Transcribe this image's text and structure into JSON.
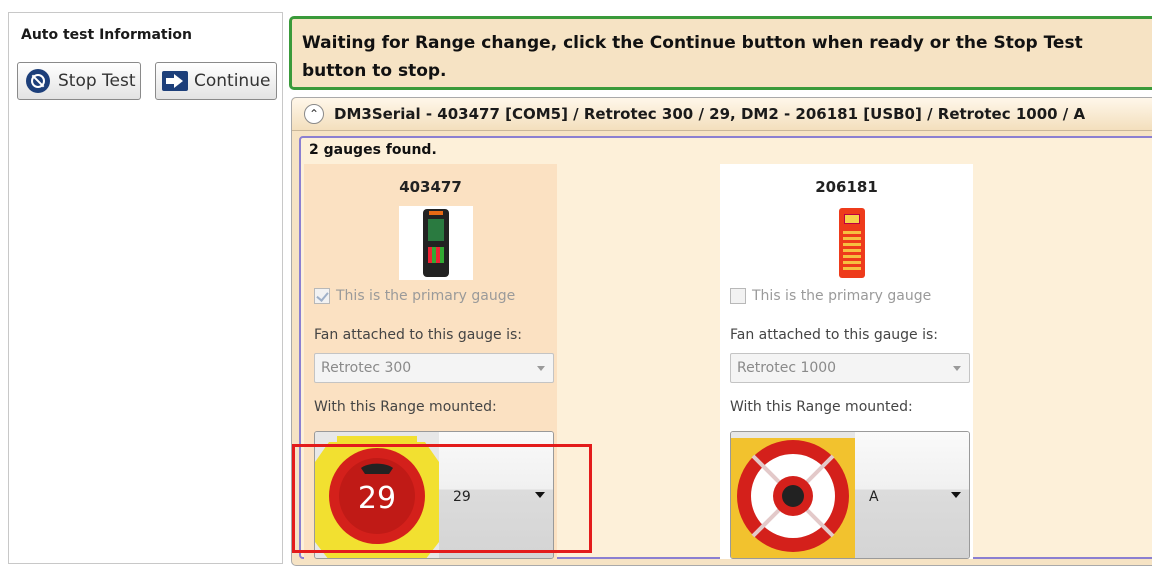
{
  "left_panel": {
    "title": "Auto test Information",
    "stop_label": "Stop Test",
    "continue_label": "Continue"
  },
  "banner": {
    "message": "Waiting for Range change, click the Continue button when ready or the Stop Test button to stop."
  },
  "device_panel": {
    "title": "DM3Serial - 403477 [COM5] / Retrotec 300 / 29, DM2 - 206181 [USB0] / Retrotec 1000 / A",
    "found_text": "2 gauges found.",
    "gauges": [
      {
        "id": "403477",
        "primary_label": "This is the primary gauge",
        "primary_checked": true,
        "fan_label": "Fan attached to this gauge is:",
        "fan_value": "Retrotec 300",
        "range_label": "With this Range mounted:",
        "range_value": "29",
        "range_badge": "29"
      },
      {
        "id": "206181",
        "primary_label": "This is the primary gauge",
        "primary_checked": false,
        "fan_label": "Fan attached to this gauge is:",
        "fan_value": "Retrotec 1000",
        "range_label": "With this Range mounted:",
        "range_value": "A"
      }
    ]
  },
  "colors": {
    "banner_bg": "#f6e3c4",
    "banner_border": "#3a9a3a",
    "highlight": "#e31b1b",
    "ring_red": "#d4201b",
    "plate_yellow": "#f2e030"
  },
  "icons": {
    "stop": "stop-circle-icon",
    "continue": "arrow-right-icon",
    "collapse": "chevron-up-icon"
  }
}
